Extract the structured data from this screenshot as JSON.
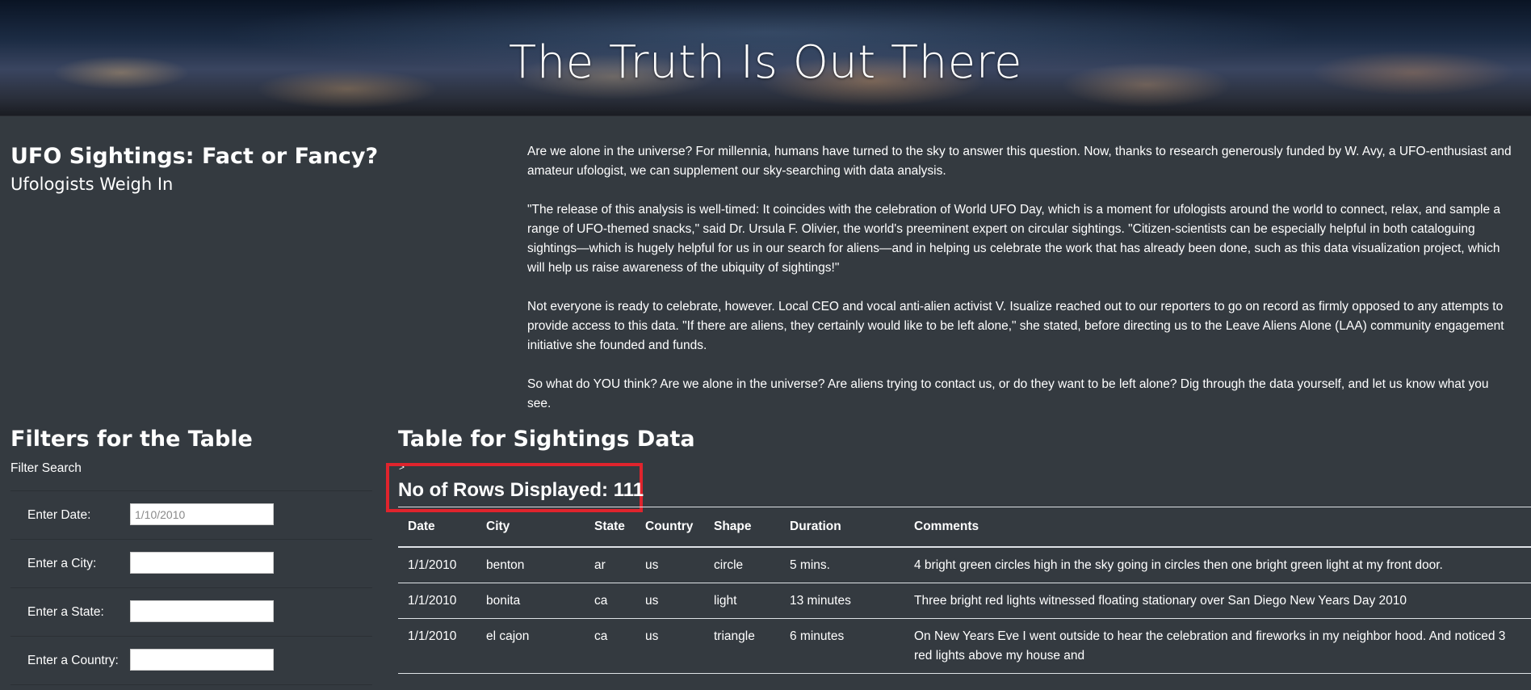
{
  "banner": {
    "title": "The Truth Is Out There"
  },
  "intro": {
    "title": "UFO Sightings: Fact or Fancy?",
    "subtitle": "Ufologists Weigh In"
  },
  "article": {
    "p1_line1": "Are we alone in the universe? For millennia, humans have turned to the sky to answer this question. Now, thanks to research generously funded by W. Avy, a UFO-enthusiast and",
    "p1_line2": "amateur ufologist, we can supplement our sky-searching with data analysis.",
    "p2_line1": "\"The release of this analysis is well-timed: It coincides with the celebration of World UFO Day, which is a moment for ufologists around the world to connect, relax, and sample a",
    "p2_line2": "range of UFO-themed snacks,\" said Dr. Ursula F. Olivier, the world's preeminent expert on circular sightings. \"Citizen-scientists can be especially helpful in both cataloguing",
    "p2_line3": "sightings—which is hugely helpful for us in our search for aliens—and in helping us celebrate the work that has already been done, such as this data visualization project, which",
    "p2_line4": "will help us raise awareness of the ubiquity of sightings!\"",
    "p3_line1": "Not everyone is ready to celebrate, however. Local CEO and vocal anti-alien activist V. Isualize reached out to our reporters to go on record as firmly opposed to any attempts to",
    "p3_line2": "provide access to this data. \"If there are aliens, they certainly would like to be left alone,\" she stated, before directing us to the Leave Aliens Alone (LAA) community engagement",
    "p3_line3": "initiative she founded and funds.",
    "p4_line1": "So what do YOU think? Are we alone in the universe? Are aliens trying to contact us, or do they want to be left alone? Dig through the data yourself, and let us know what you",
    "p4_line2": "see."
  },
  "filters": {
    "title": "Filters for the Table",
    "search_label": "Filter Search",
    "date_label": "Enter Date:",
    "date_placeholder": "1/10/2010",
    "city_label": "Enter a City:",
    "state_label": "Enter a State:",
    "country_label": "Enter a Country:"
  },
  "table_section": {
    "title": "Table for Sightings Data",
    "marker": ">",
    "rows_displayed": "No of Rows Displayed: 111",
    "highlight_color": "#e0242d"
  },
  "table": {
    "headers": {
      "date": "Date",
      "city": "City",
      "state": "State",
      "country": "Country",
      "shape": "Shape",
      "duration": "Duration",
      "comments": "Comments"
    },
    "rows": [
      {
        "date": "1/1/2010",
        "city": "benton",
        "state": "ar",
        "country": "us",
        "shape": "circle",
        "duration": "5 mins.",
        "comments": "4 bright green circles high in the sky going in circles then one bright green light at my front door."
      },
      {
        "date": "1/1/2010",
        "city": "bonita",
        "state": "ca",
        "country": "us",
        "shape": "light",
        "duration": "13 minutes",
        "comments": "Three bright red lights witnessed floating stationary over San Diego New Years Day 2010"
      },
      {
        "date": "1/1/2010",
        "city": "el cajon",
        "state": "ca",
        "country": "us",
        "shape": "triangle",
        "duration": "6 minutes",
        "comments": "On New Years Eve I went outside to hear the celebration and fireworks in my neighbor hood. And noticed 3 red lights above my house and"
      }
    ]
  }
}
